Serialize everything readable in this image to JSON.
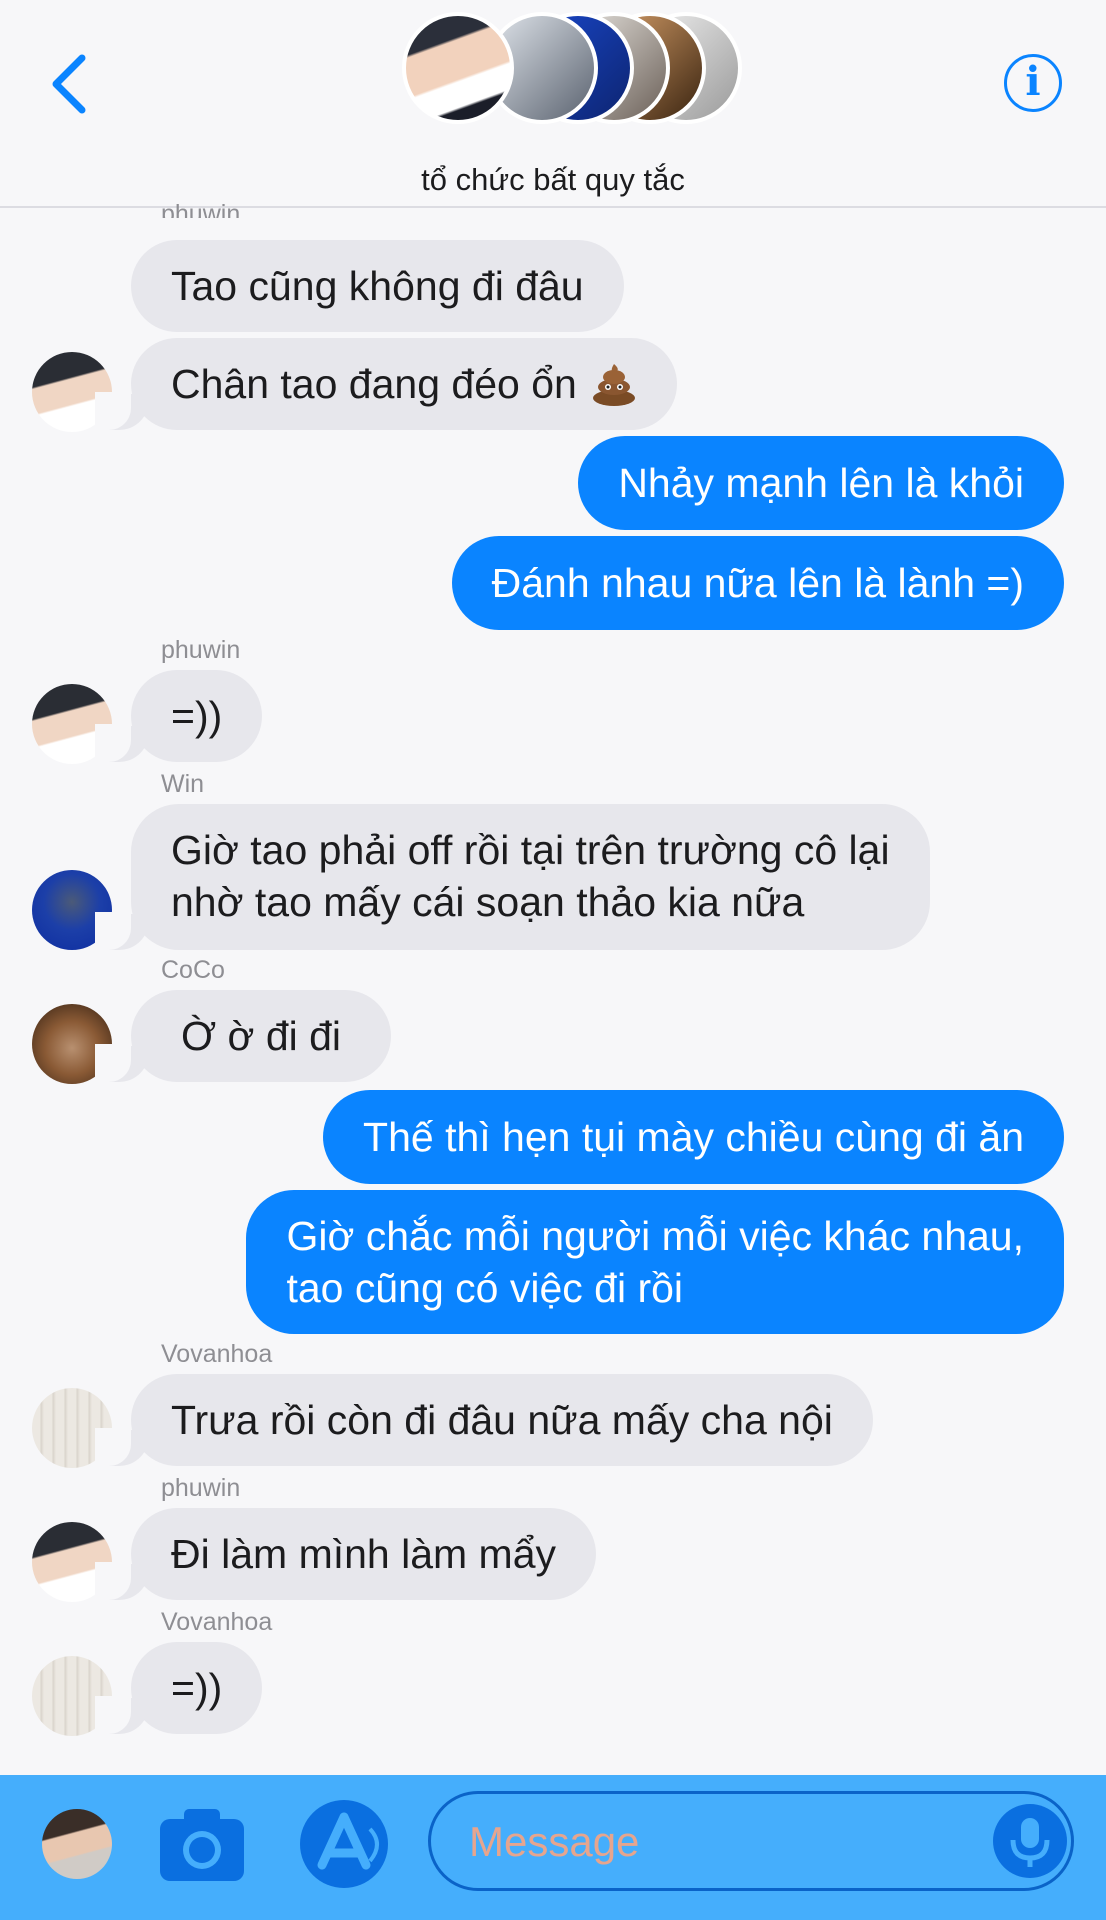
{
  "header": {
    "group_name": "tổ chức bất quy tắc",
    "back_icon": "chevron-left-icon",
    "info_icon": "info-circle-icon",
    "accent_color": "#0a84ff"
  },
  "messages": {
    "partial_sender": "phuwin",
    "items": [
      {
        "id": "m1",
        "direction": "incoming",
        "text": "Tao cũng không đi đâu"
      },
      {
        "id": "m2",
        "direction": "incoming",
        "text": "Chân tao đang đéo ổn",
        "emoji": "pile-of-poo-icon"
      },
      {
        "id": "m3",
        "direction": "outgoing",
        "text": "Nhảy mạnh lên là khỏi"
      },
      {
        "id": "m4",
        "direction": "outgoing",
        "text": "Đánh nhau nữa lên là lành =)"
      },
      {
        "id": "m5",
        "direction": "incoming",
        "sender": "phuwin",
        "text": "=))"
      },
      {
        "id": "m6",
        "direction": "incoming",
        "sender": "Win",
        "text_line1": "Giờ tao phải off rồi tại trên trường cô lại",
        "text_line2": "nhờ tao mấy cái soạn thảo kia nữa"
      },
      {
        "id": "m7",
        "direction": "incoming",
        "sender": "CoCo",
        "text": "Ờ ờ đi đi"
      },
      {
        "id": "m8",
        "direction": "outgoing",
        "text": "Thế thì hẹn tụi mày chiều cùng đi ăn"
      },
      {
        "id": "m9",
        "direction": "outgoing",
        "text_line1": "Giờ chắc mỗi người mỗi việc khác nhau,",
        "text_line2": "tao cũng có việc đi rồi"
      },
      {
        "id": "m10",
        "direction": "incoming",
        "sender": "Vovanhoa",
        "text": "Trưa rồi còn đi đâu nữa mấy cha nội"
      },
      {
        "id": "m11",
        "direction": "incoming",
        "sender": "phuwin",
        "text": "Đi làm mình làm mẩy"
      },
      {
        "id": "m12",
        "direction": "incoming",
        "sender": "Vovanhoa",
        "text": "=))"
      }
    ],
    "incoming_color": "#e7e7ec",
    "outgoing_color": "#0a84ff"
  },
  "composer": {
    "placeholder": "Message",
    "camera_icon": "camera-icon",
    "apps_icon": "app-store-icon",
    "mic_icon": "microphone-icon",
    "bar_color": "#45aefc"
  }
}
